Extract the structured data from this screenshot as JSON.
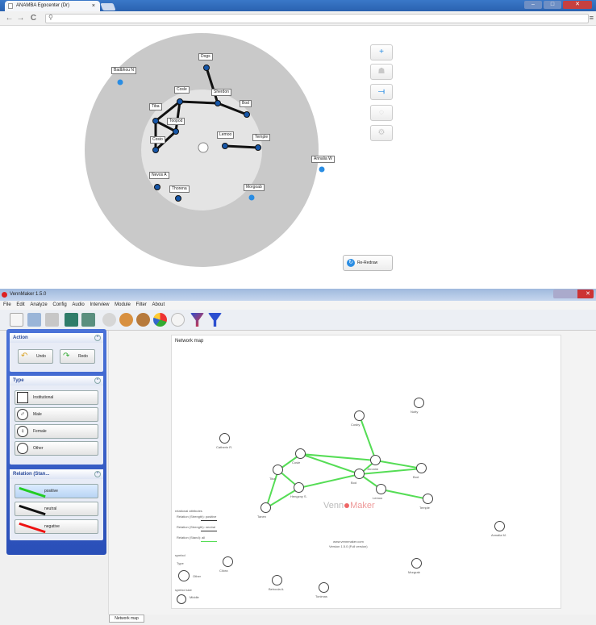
{
  "browser": {
    "tab_title": "ANAMBA Egocenter (Dr)",
    "tab_close": "×",
    "nav": {
      "back": "←",
      "forward": "→",
      "reload": "C"
    },
    "url": ""
  },
  "circle_map": {
    "outer_color": "#c9c9c9",
    "inner_color": "#e4e4e4",
    "node_color": "#2a8de3",
    "nodes": [
      {
        "label": "Badbhou N"
      },
      {
        "label": "Dogs"
      },
      {
        "label": "Cosle"
      },
      {
        "label": "Sherdon"
      },
      {
        "label": "Bod"
      },
      {
        "label": "Tiba"
      },
      {
        "label": "Toopod"
      },
      {
        "label": "Cosio"
      },
      {
        "label": "Lemoo"
      },
      {
        "label": "Temple"
      },
      {
        "label": "Annalia W"
      },
      {
        "label": "Nevos A"
      },
      {
        "label": "Thorena"
      },
      {
        "label": "Morgoab"
      }
    ],
    "tools": [
      {
        "icon": "plus-icon",
        "glyph": "+"
      },
      {
        "icon": "person-icon",
        "glyph": "☗"
      },
      {
        "icon": "connect-icon",
        "glyph": "⟞"
      },
      {
        "icon": "circle-select-icon",
        "glyph": "◌"
      },
      {
        "icon": "settings-icon",
        "glyph": "⚙"
      }
    ],
    "redraw_label": "Re-Redraw"
  },
  "venn": {
    "title": "VennMaker 1.5.0",
    "menu": [
      "File",
      "Edit",
      "Analyze",
      "Config",
      "Audio",
      "Interview",
      "Module",
      "Filter",
      "About"
    ],
    "panels": {
      "action": {
        "title": "Action",
        "undo": "Undo",
        "redo": "Redo"
      },
      "type": {
        "title": "Type",
        "items": [
          "Institutional",
          "Male",
          "Female",
          "Other"
        ]
      },
      "relation": {
        "title": "Relation (Stan...",
        "items": [
          "positive",
          "neutral",
          "negative"
        ],
        "colors": [
          "#22cc22",
          "#111111",
          "#ee1111"
        ]
      }
    },
    "canvas": {
      "title": "Network map",
      "watermark_a": "Venn",
      "watermark_b": "Maker",
      "watermark_url": "www.vennmaker.com",
      "watermark_version": "Version 1.5.0 (Full version)",
      "edge_color": "#55dd55",
      "legend": {
        "heading": "relational attributes",
        "r1": "Relation (Strength): positive",
        "r2": "Relation (Strength): neutral",
        "r3": "Relation (Stand): all",
        "symbol": "symbol",
        "type": "Type",
        "other": "Other",
        "size": "symbol size",
        "size_val": "Middle"
      },
      "nodes": [
        {
          "label": "Nutty"
        },
        {
          "label": "Cosby"
        },
        {
          "label": "Catherin R."
        },
        {
          "label": "Cosle"
        },
        {
          "label": "Jeronim"
        },
        {
          "label": "Bod"
        },
        {
          "label": "Tiba"
        },
        {
          "label": "Bod"
        },
        {
          "label": "Lemoo"
        },
        {
          "label": "Hengzny S."
        },
        {
          "label": "Tanen"
        },
        {
          "label": "Temple"
        },
        {
          "label": "Annalia M."
        },
        {
          "label": "Morgrab"
        },
        {
          "label": "Cilora"
        },
        {
          "label": "Behoula A."
        },
        {
          "label": "Tonimas"
        }
      ]
    },
    "bottom_tab": "Network map"
  }
}
